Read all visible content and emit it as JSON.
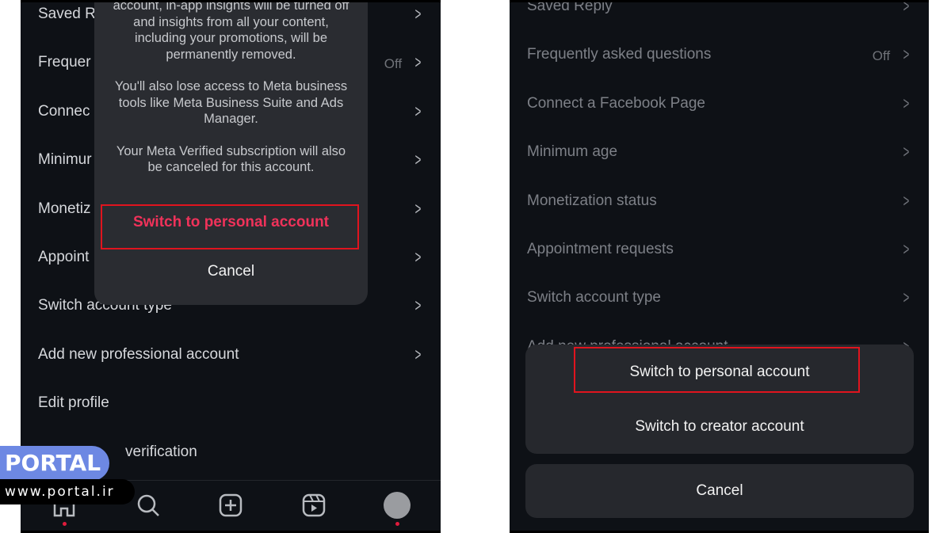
{
  "left": {
    "rows": [
      {
        "label": "Saved R"
      },
      {
        "label": "Frequer",
        "value": "Off"
      },
      {
        "label": "Connec"
      },
      {
        "label": "Minimur"
      },
      {
        "label": "Monetiz"
      },
      {
        "label": "Appoint"
      },
      {
        "label": "Switch account type"
      },
      {
        "label": "Add new professional account"
      },
      {
        "label": "Edit profile"
      },
      {
        "label": "verification"
      }
    ],
    "dialog": {
      "paragraphs": [
        "account, in-app insights will be turned off and insights from all your content, including your promotions, will be permanently removed.",
        "You'll also lose access to Meta business tools like Meta Business Suite and Ads Manager.",
        "Your Meta Verified subscription will also be canceled for this account."
      ],
      "confirm": "Switch to personal account",
      "cancel": "Cancel"
    },
    "tabs": [
      "home-icon",
      "search-icon",
      "create-icon",
      "reels-icon",
      "profile-avatar"
    ]
  },
  "right": {
    "rows": [
      {
        "label": "Saved Reply"
      },
      {
        "label": "Frequently asked questions",
        "value": "Off"
      },
      {
        "label": "Connect a Facebook Page"
      },
      {
        "label": "Minimum age"
      },
      {
        "label": "Monetization status"
      },
      {
        "label": "Appointment requests"
      },
      {
        "label": "Switch account type"
      },
      {
        "label": "Add new professional account"
      }
    ],
    "sheet": {
      "personal": "Switch to personal account",
      "creator": "Switch to creator account",
      "cancel": "Cancel"
    }
  },
  "watermark": {
    "brand": "PORTAL",
    "url": "www.portal.ir"
  },
  "colors": {
    "highlight": "#e0141e",
    "danger": "#f0325a",
    "watermark": "#6d88e3"
  }
}
